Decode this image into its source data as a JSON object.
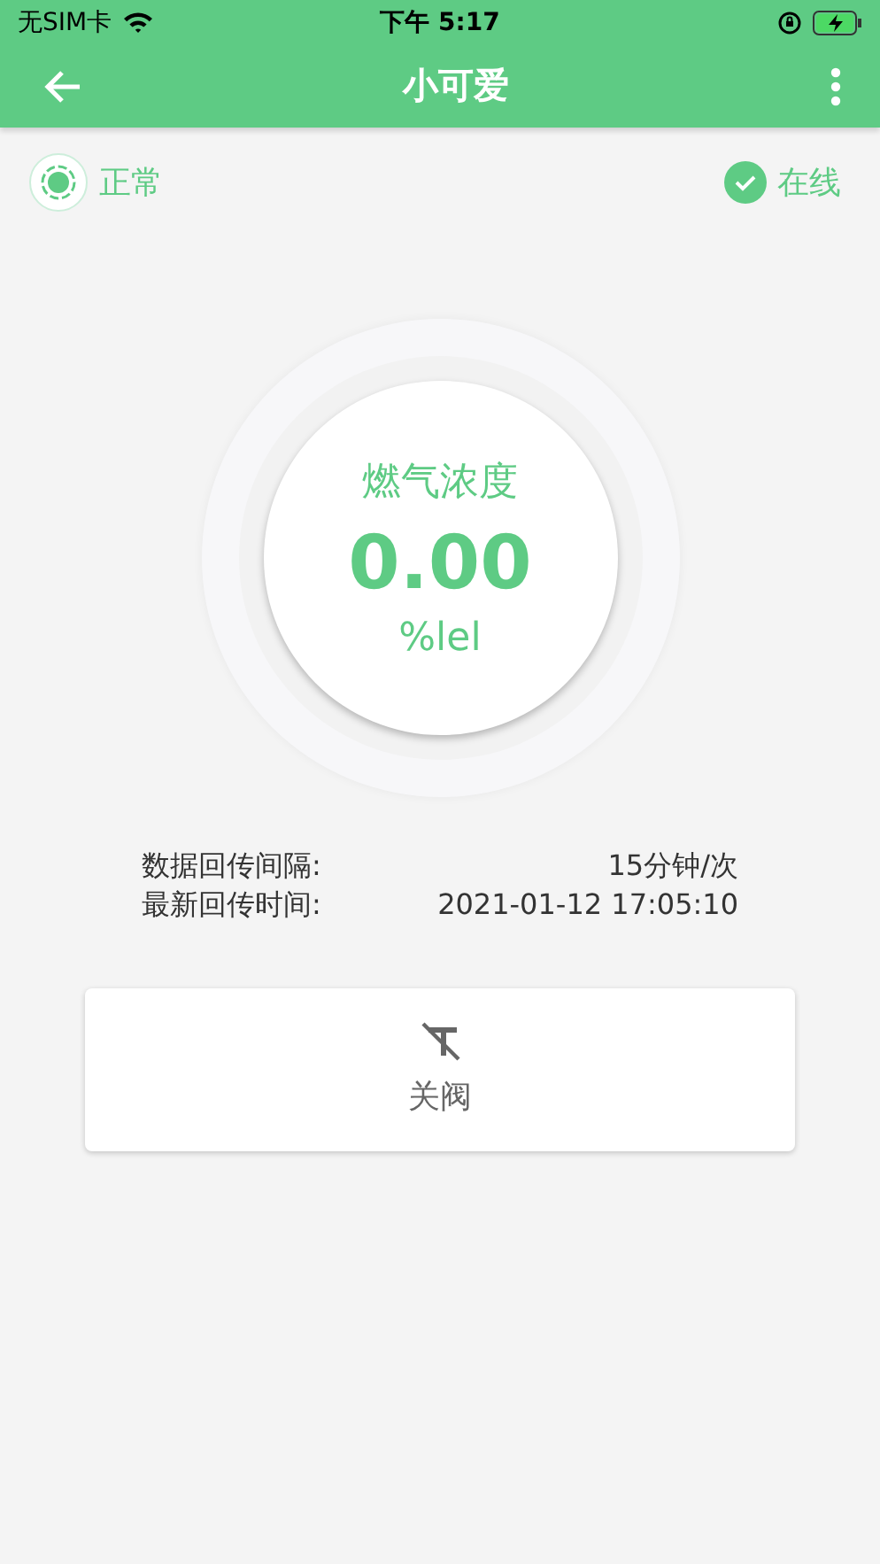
{
  "status_bar": {
    "carrier": "无SIM卡",
    "time": "下午 5:17"
  },
  "header": {
    "title": "小可爱"
  },
  "device_status": {
    "state": "正常",
    "connection": "在线"
  },
  "gauge": {
    "label": "燃气浓度",
    "value": "0.00",
    "unit": "%lel"
  },
  "info": [
    {
      "label": "数据回传间隔:",
      "value": "15分钟/次"
    },
    {
      "label": "最新回传时间:",
      "value": "2021-01-12 17:05:10"
    }
  ],
  "actions": [
    {
      "label": "关阀"
    }
  ]
}
